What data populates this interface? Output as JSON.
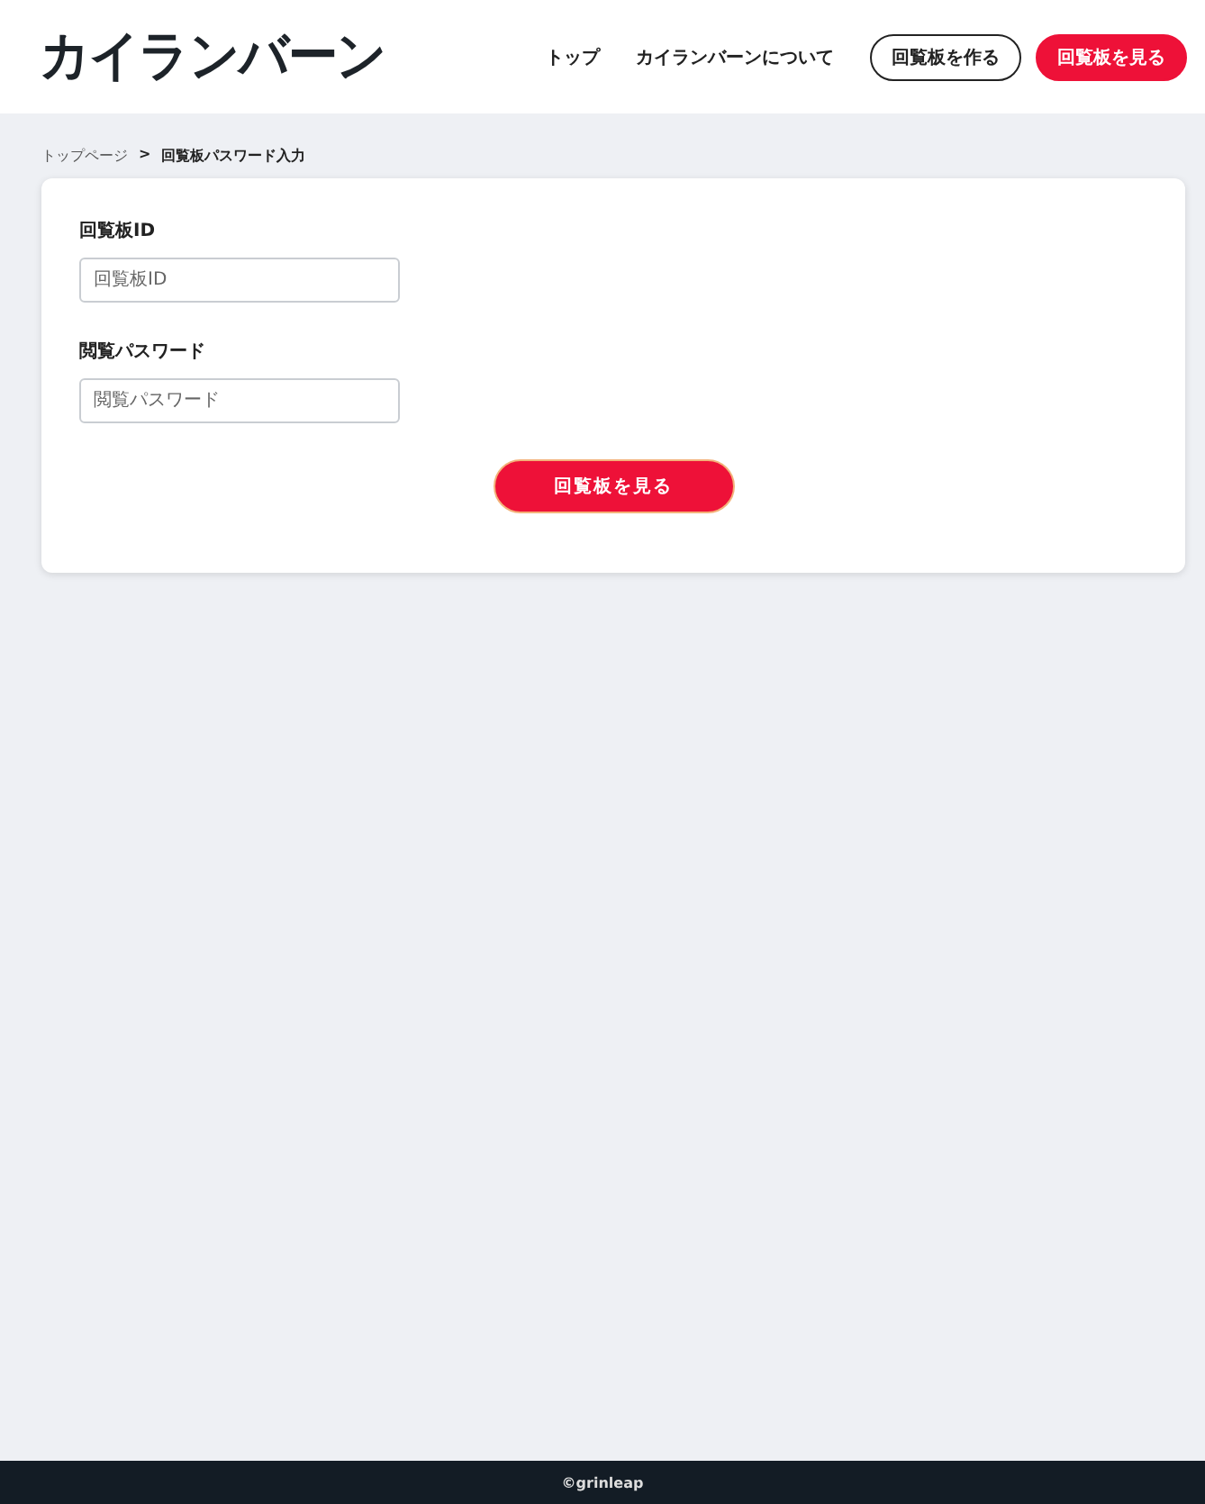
{
  "header": {
    "logo": "カイランバーン",
    "nav": [
      {
        "label": "トップ"
      },
      {
        "label": "カイランバーンについて"
      }
    ],
    "buttons": [
      {
        "label": "回覧板を作る",
        "kind": "outline"
      },
      {
        "label": "回覧板を見る",
        "kind": "primary"
      }
    ]
  },
  "breadcrumb": [
    {
      "label": "トップページ",
      "kind": "link"
    },
    {
      "label": ">",
      "kind": "separator"
    },
    {
      "label": "回覧板パスワード入力",
      "kind": "current"
    }
  ],
  "form": {
    "fields": [
      {
        "label": "回覧板ID",
        "placeholder": "回覧板ID"
      },
      {
        "label": "閲覧パスワード",
        "placeholder": "閲覧パスワード"
      }
    ],
    "submit": "回覧板を見る"
  },
  "footer": {
    "copyright": "©grinleap"
  }
}
